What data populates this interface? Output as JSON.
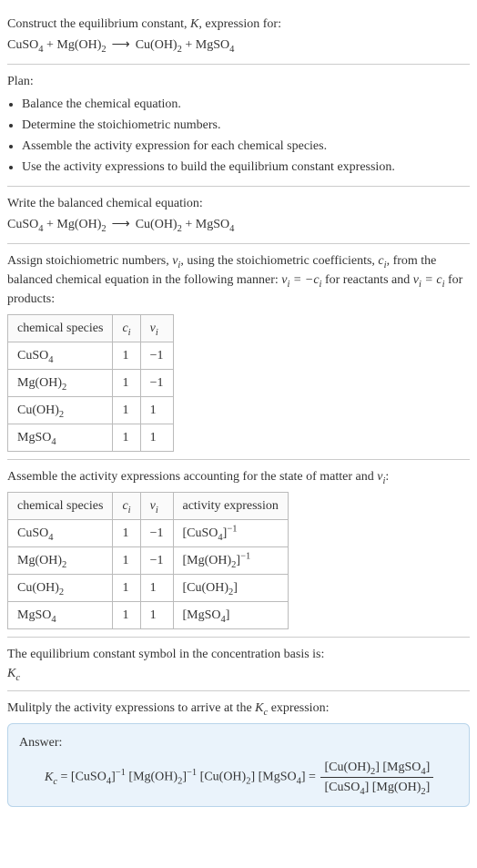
{
  "intro": {
    "line1": "Construct the equilibrium constant, K, expression for:",
    "equation": "CuSO₄ + Mg(OH)₂  ⟶  Cu(OH)₂ + MgSO₄"
  },
  "plan": {
    "heading": "Plan:",
    "items": [
      "Balance the chemical equation.",
      "Determine the stoichiometric numbers.",
      "Assemble the activity expression for each chemical species.",
      "Use the activity expressions to build the equilibrium constant expression."
    ]
  },
  "balanced": {
    "heading": "Write the balanced chemical equation:",
    "equation": "CuSO₄ + Mg(OH)₂  ⟶  Cu(OH)₂ + MgSO₄"
  },
  "assign": {
    "text_pre": "Assign stoichiometric numbers, ",
    "nu": "νᵢ",
    "text_mid1": ", using the stoichiometric coefficients, ",
    "ci": "cᵢ",
    "text_mid2": ", from the balanced chemical equation in the following manner: ",
    "rel1": "νᵢ = −cᵢ",
    "text_mid3": " for reactants and ",
    "rel2": "νᵢ = cᵢ",
    "text_end": " for products:",
    "headers": [
      "chemical species",
      "cᵢ",
      "νᵢ"
    ],
    "rows": [
      {
        "species": "CuSO₄",
        "ci": "1",
        "nu": "−1"
      },
      {
        "species": "Mg(OH)₂",
        "ci": "1",
        "nu": "−1"
      },
      {
        "species": "Cu(OH)₂",
        "ci": "1",
        "nu": "1"
      },
      {
        "species": "MgSO₄",
        "ci": "1",
        "nu": "1"
      }
    ]
  },
  "activity": {
    "heading": "Assemble the activity expressions accounting for the state of matter and νᵢ:",
    "headers": [
      "chemical species",
      "cᵢ",
      "νᵢ",
      "activity expression"
    ],
    "rows": [
      {
        "species": "CuSO₄",
        "ci": "1",
        "nu": "−1",
        "expr": "[CuSO₄]⁻¹"
      },
      {
        "species": "Mg(OH)₂",
        "ci": "1",
        "nu": "−1",
        "expr": "[Mg(OH)₂]⁻¹"
      },
      {
        "species": "Cu(OH)₂",
        "ci": "1",
        "nu": "1",
        "expr": "[Cu(OH)₂]"
      },
      {
        "species": "MgSO₄",
        "ci": "1",
        "nu": "1",
        "expr": "[MgSO₄]"
      }
    ]
  },
  "symbol": {
    "heading": "The equilibrium constant symbol in the concentration basis is:",
    "value": "K_c"
  },
  "multiply": {
    "heading": "Mulitply the activity expressions to arrive at the K_c expression:"
  },
  "answer": {
    "label": "Answer:",
    "lhs": "K_c = [CuSO₄]⁻¹ [Mg(OH)₂]⁻¹ [Cu(OH)₂] [MgSO₄] = ",
    "frac_num": "[Cu(OH)₂] [MgSO₄]",
    "frac_den": "[CuSO₄] [Mg(OH)₂]"
  },
  "chart_data": [
    {
      "type": "table",
      "title": "Stoichiometric numbers",
      "columns": [
        "chemical species",
        "c_i",
        "nu_i"
      ],
      "rows": [
        [
          "CuSO4",
          1,
          -1
        ],
        [
          "Mg(OH)2",
          1,
          -1
        ],
        [
          "Cu(OH)2",
          1,
          1
        ],
        [
          "MgSO4",
          1,
          1
        ]
      ]
    },
    {
      "type": "table",
      "title": "Activity expressions",
      "columns": [
        "chemical species",
        "c_i",
        "nu_i",
        "activity expression"
      ],
      "rows": [
        [
          "CuSO4",
          1,
          -1,
          "[CuSO4]^-1"
        ],
        [
          "Mg(OH)2",
          1,
          -1,
          "[Mg(OH)2]^-1"
        ],
        [
          "Cu(OH)2",
          1,
          1,
          "[Cu(OH)2]"
        ],
        [
          "MgSO4",
          1,
          1,
          "[MgSO4]"
        ]
      ]
    }
  ]
}
